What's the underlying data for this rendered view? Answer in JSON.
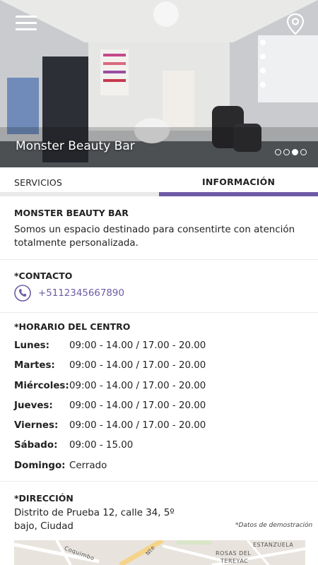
{
  "hero": {
    "title": "Monster Beauty Bar",
    "slide_count": 4,
    "active_slide": 3,
    "menu_icon": "hamburger-menu-icon",
    "location_icon": "map-pin-icon"
  },
  "tabs": [
    {
      "label": "SERVICIOS",
      "active": false
    },
    {
      "label": "INFORMACIÓN",
      "active": true
    }
  ],
  "colors": {
    "accent": "#6e5ba5",
    "inactive_tab_bar": "#e9e9ea",
    "divider": "#ececec"
  },
  "about": {
    "heading": "MONSTER BEAUTY BAR",
    "text": "Somos un espacio destinado para consentirte con atención totalmente personalizada."
  },
  "contact": {
    "heading": "*CONTACTO",
    "phone": "+5112345667890",
    "phone_icon": "phone-icon"
  },
  "hours": {
    "heading": "*HORARIO DEL CENTRO",
    "rows": [
      {
        "day": "Lunes:",
        "time": "09:00 - 14.00  /  17.00 - 20.00"
      },
      {
        "day": "Martes:",
        "time": "09:00 - 14.00  /  17.00 - 20.00"
      },
      {
        "day": "Miércoles:",
        "time": "09:00 - 14.00  /  17.00 - 20.00"
      },
      {
        "day": "Jueves:",
        "time": "09:00 - 14.00  /  17.00 - 20.00"
      },
      {
        "day": "Viernes:",
        "time": "09:00 - 14.00  /  17.00 - 20.00"
      },
      {
        "day": "Sábado:",
        "time": "09:00 - 15.00"
      },
      {
        "day": "Domingo:",
        "time": "Cerrado"
      }
    ]
  },
  "address": {
    "heading": "*DIRECCIÓN",
    "text": "Distrito de Prueba 12, calle 34, 5º bajo, Ciudad",
    "note": "*Datos de demostración"
  },
  "map": {
    "labels": [
      "Coquimbo",
      "Nte",
      "ESTANZUELA",
      "ROSAS DEL",
      "TEREYAC"
    ]
  }
}
